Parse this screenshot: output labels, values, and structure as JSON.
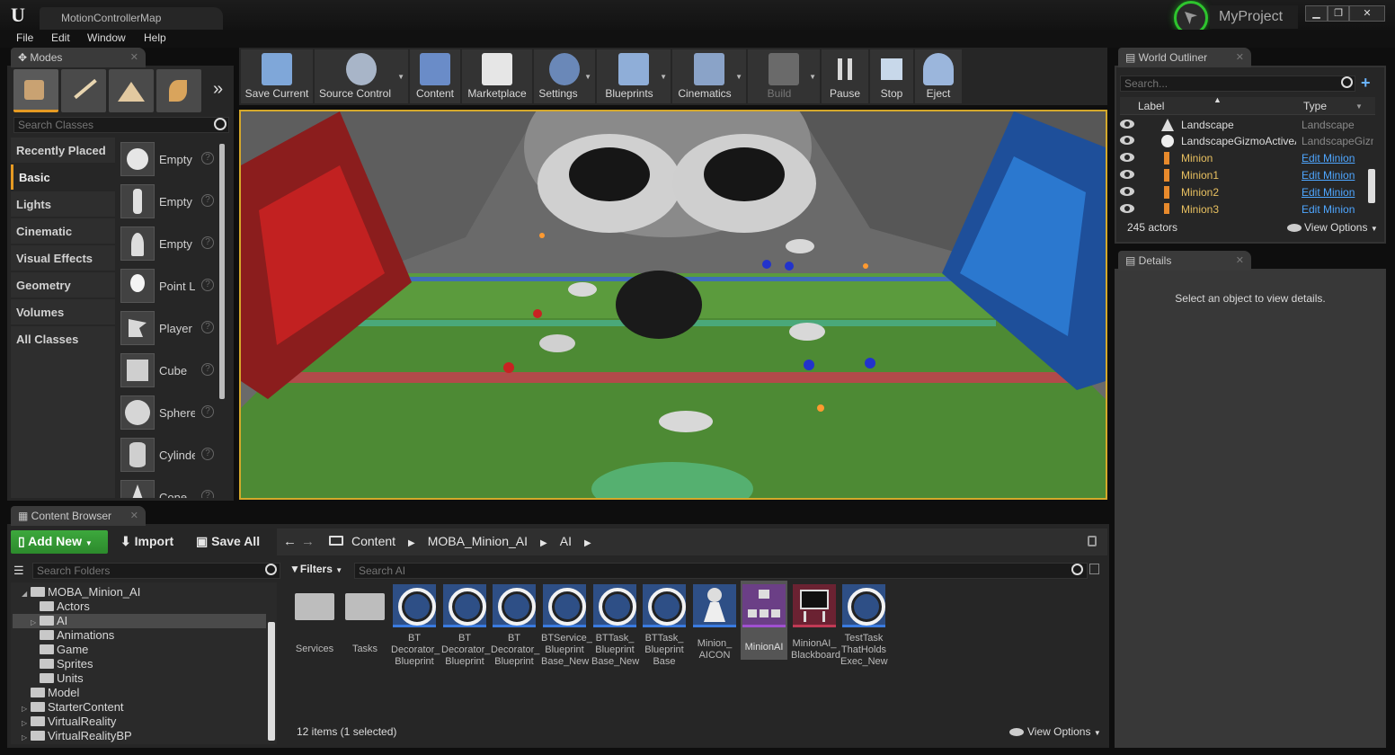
{
  "window": {
    "tab_title": "MotionControllerMap",
    "project": "MyProject",
    "minimize": "▁",
    "restore": "❐",
    "close": "✕"
  },
  "menu": [
    "File",
    "Edit",
    "Window",
    "Help"
  ],
  "modes": {
    "tab": "Modes",
    "search_placeholder": "Search Classes",
    "categories": [
      "Recently Placed",
      "Basic",
      "Lights",
      "Cinematic",
      "Visual Effects",
      "Geometry",
      "Volumes",
      "All Classes"
    ],
    "selected_category": "Basic",
    "classes": [
      "Empty",
      "Empty",
      "Empty",
      "Point L",
      "Player",
      "Cube",
      "Sphere",
      "Cylinde",
      "Cone"
    ],
    "more": "»"
  },
  "toolbar": {
    "buttons": [
      "Save Current",
      "Source Control",
      "Content",
      "Marketplace",
      "Settings",
      "Blueprints",
      "Cinematics",
      "Build",
      "Pause",
      "Stop",
      "Eject"
    ]
  },
  "outliner": {
    "tab": "World Outliner",
    "search_placeholder": "Search...",
    "col_label": "Label",
    "col_type": "Type",
    "rows": [
      {
        "name": "Landscape",
        "type": "Landscape",
        "link": false
      },
      {
        "name": "LandscapeGizmoActiveActor",
        "type": "LandscapeGizmo",
        "link": false
      },
      {
        "name": "Minion",
        "type": "Edit Minion",
        "link": true
      },
      {
        "name": "Minion1",
        "type": "Edit Minion",
        "link": true
      },
      {
        "name": "Minion2",
        "type": "Edit Minion",
        "link": true
      },
      {
        "name": "Minion3",
        "type": "Edit Minion",
        "link": true
      }
    ],
    "count": "245 actors",
    "view_options": "View Options"
  },
  "details": {
    "tab": "Details",
    "empty": "Select an object to view details."
  },
  "content_browser": {
    "tab": "Content Browser",
    "add_new": "Add New",
    "import": "Import",
    "save_all": "Save All",
    "breadcrumb": [
      "Content",
      "MOBA_Minion_AI",
      "AI"
    ],
    "search_folders": "Search Folders",
    "filters": "Filters",
    "search_ai": "Search AI",
    "tree": [
      {
        "label": "MOBA_Minion_AI",
        "indent": 1,
        "arrow": "◢"
      },
      {
        "label": "Actors",
        "indent": 2,
        "arrow": ""
      },
      {
        "label": "AI",
        "indent": 2,
        "arrow": "▷",
        "selected": true
      },
      {
        "label": "Animations",
        "indent": 2,
        "arrow": ""
      },
      {
        "label": "Game",
        "indent": 2,
        "arrow": ""
      },
      {
        "label": "Sprites",
        "indent": 2,
        "arrow": ""
      },
      {
        "label": "Units",
        "indent": 2,
        "arrow": ""
      },
      {
        "label": "Model",
        "indent": 1,
        "arrow": ""
      },
      {
        "label": "StarterContent",
        "indent": 1,
        "arrow": "▷"
      },
      {
        "label": "VirtualReality",
        "indent": 1,
        "arrow": "▷"
      },
      {
        "label": "VirtualRealityBP",
        "indent": 1,
        "arrow": "▷"
      }
    ],
    "assets": [
      {
        "label": "Services",
        "kind": "folder"
      },
      {
        "label": "Tasks",
        "kind": "folder"
      },
      {
        "label": "BT Decorator_ Blueprint",
        "kind": "ring"
      },
      {
        "label": "BT Decorator_ Blueprint",
        "kind": "ring"
      },
      {
        "label": "BT Decorator_ Blueprint",
        "kind": "ring"
      },
      {
        "label": "BTService_ Blueprint Base_New",
        "kind": "ring"
      },
      {
        "label": "BTTask_ Blueprint Base_New",
        "kind": "ring"
      },
      {
        "label": "BTTask_ Blueprint Base",
        "kind": "ring"
      },
      {
        "label": "Minion_ AICON",
        "kind": "aicon"
      },
      {
        "label": "MinionAI",
        "kind": "tree",
        "selected": true
      },
      {
        "label": "MinionAI_ Blackboard",
        "kind": "board"
      },
      {
        "label": "TestTask ThatHolds Exec_New",
        "kind": "ring"
      }
    ],
    "status": "12 items (1 selected)",
    "view_options": "View Options"
  }
}
